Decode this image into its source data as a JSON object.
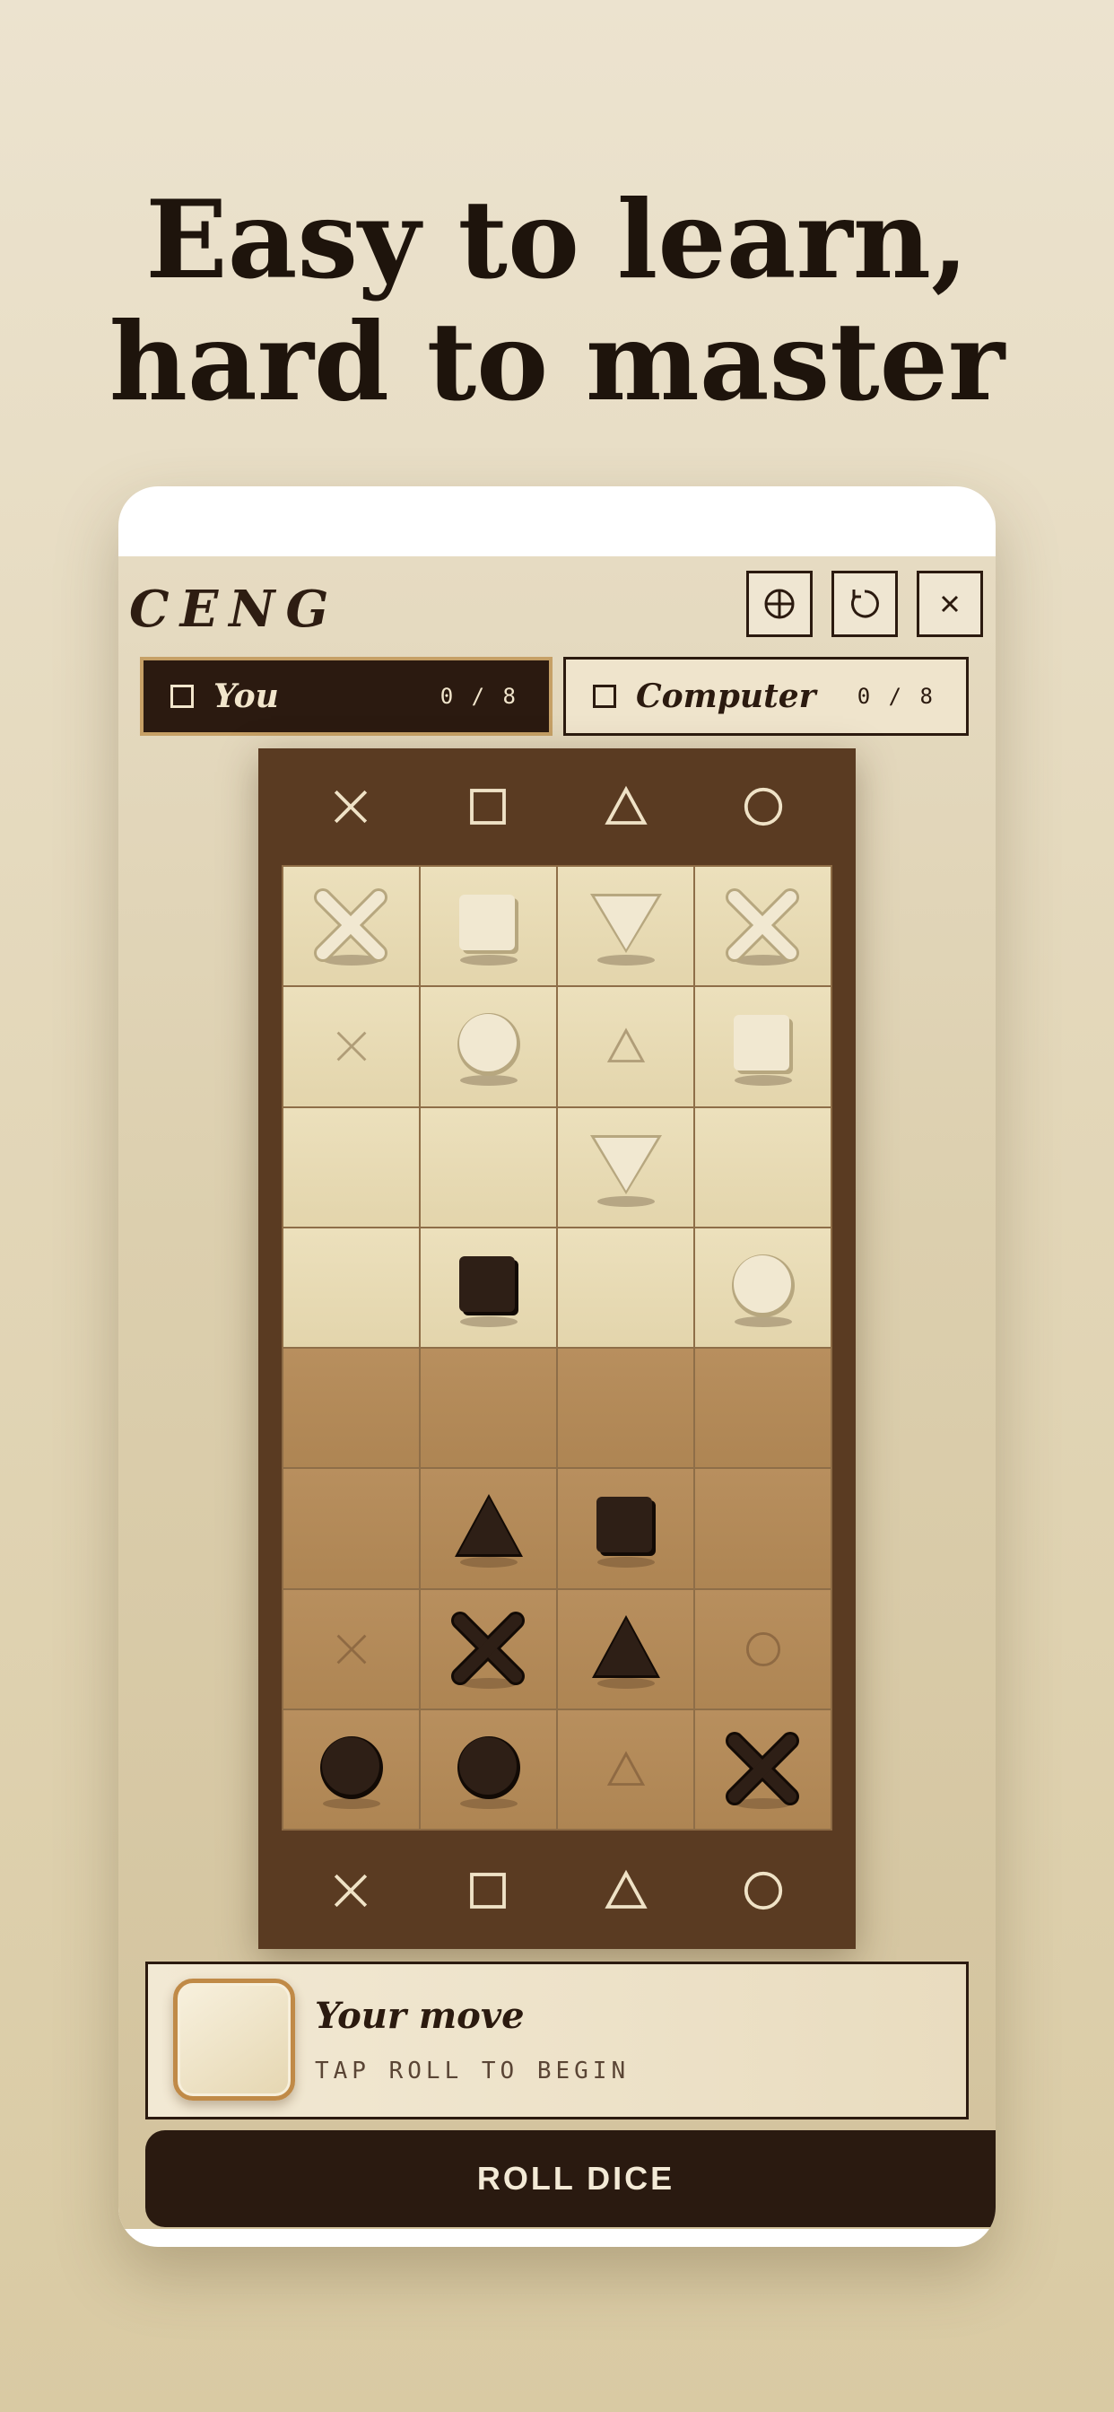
{
  "headline": {
    "line1": "Easy to learn,",
    "line2": "hard to master"
  },
  "app": {
    "logo": "CENG"
  },
  "toolbar": {
    "buttons": [
      "crosshair-icon",
      "restart-icon",
      "close-icon"
    ]
  },
  "players": {
    "you": {
      "name": "You",
      "score": "0 / 8"
    },
    "computer": {
      "name": "Computer",
      "score": "0 / 8"
    }
  },
  "board": {
    "column_symbols": [
      "cross",
      "square",
      "triangle",
      "circle"
    ],
    "rows": [
      [
        {
          "p": "cross",
          "c": "light"
        },
        {
          "p": "square",
          "c": "light"
        },
        {
          "p": "triangle-down",
          "c": "light"
        },
        {
          "p": "cross",
          "c": "light"
        }
      ],
      [
        {
          "h": "cross"
        },
        {
          "p": "circle",
          "c": "light"
        },
        {
          "h": "triangle"
        },
        {
          "p": "square",
          "c": "light"
        }
      ],
      [
        {},
        {},
        {
          "p": "triangle-down",
          "c": "light"
        },
        {}
      ],
      [
        {},
        {
          "p": "square",
          "c": "dark"
        },
        {},
        {
          "p": "circle",
          "c": "light"
        }
      ],
      [
        {},
        {},
        {},
        {}
      ],
      [
        {},
        {
          "p": "triangle",
          "c": "dark"
        },
        {
          "p": "square",
          "c": "dark"
        },
        {}
      ],
      [
        {
          "h": "cross"
        },
        {
          "p": "cross",
          "c": "dark"
        },
        {
          "p": "triangle",
          "c": "dark"
        },
        {
          "h": "circle"
        }
      ],
      [
        {
          "p": "circle",
          "c": "dark"
        },
        {
          "p": "circle",
          "c": "dark"
        },
        {
          "h": "triangle"
        },
        {
          "p": "cross",
          "c": "dark"
        }
      ]
    ]
  },
  "status": {
    "title": "Your move",
    "subtitle": "TAP ROLL TO BEGIN"
  },
  "roll_button": {
    "label": "ROLL DICE"
  },
  "colors": {
    "ink": "#2b1a0f",
    "board": "#5a3b22",
    "light_zone": "#e8dbb4",
    "dark_zone": "#b38a58",
    "accent": "#c08a47"
  }
}
